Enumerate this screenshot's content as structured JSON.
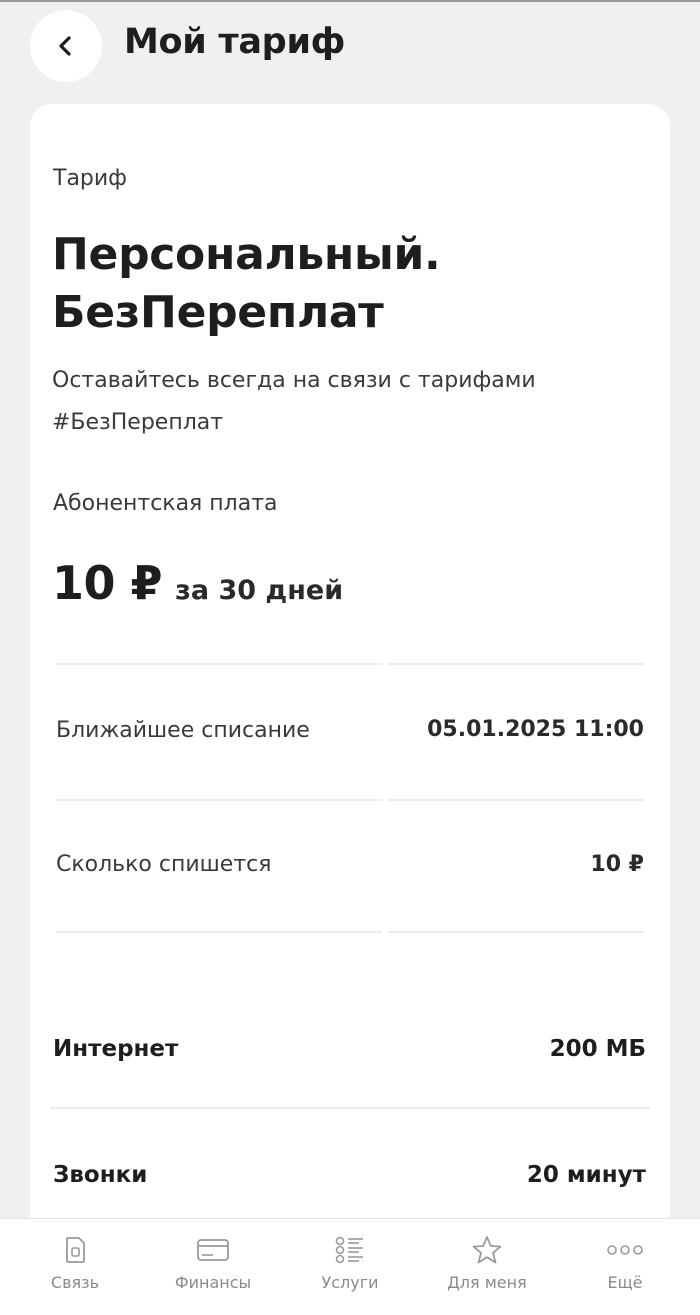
{
  "header": {
    "title": "Мой тариф",
    "back_icon": "chevron-left-icon"
  },
  "card": {
    "section_label": "Тариф",
    "tariff_name": "Персональный. БезПереплат",
    "tariff_description": "Оставайтесь всегда на связи с тарифами #БезПереплат",
    "fee_label": "Абонентская плата",
    "fee_amount": "10 ₽",
    "fee_period": "за 30 дней",
    "billing": [
      {
        "label": "Ближайшее списание",
        "value": "05.01.2025 11:00"
      },
      {
        "label": "Сколько спишется",
        "value": "10 ₽"
      }
    ],
    "features": [
      {
        "label": "Интернет",
        "value": "200 МБ"
      },
      {
        "label": "Звонки",
        "value": "20 минут"
      }
    ]
  },
  "bottom_nav": {
    "items": [
      {
        "label": "Связь",
        "icon": "sim-card-icon"
      },
      {
        "label": "Финансы",
        "icon": "card-icon"
      },
      {
        "label": "Услуги",
        "icon": "services-list-icon"
      },
      {
        "label": "Для меня",
        "icon": "star-icon"
      },
      {
        "label": "Ещё",
        "icon": "more-dots-icon"
      }
    ]
  }
}
